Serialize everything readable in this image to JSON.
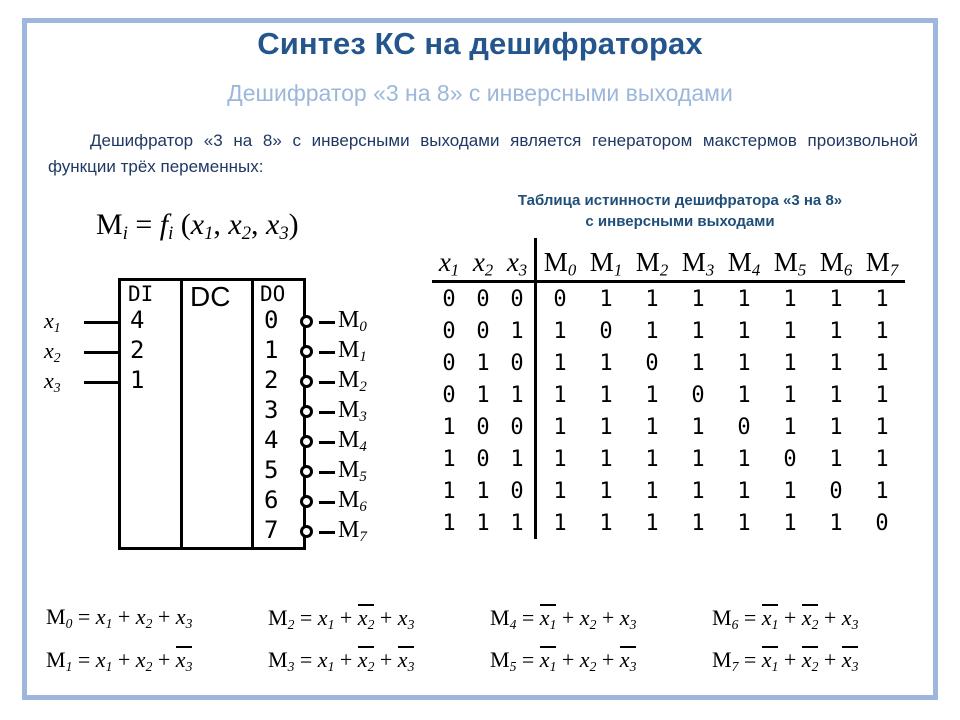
{
  "slide": {
    "title": "Синтез КС на дешифраторах",
    "subtitle": "Дешифратор «3 на 8» с инверсными выходами",
    "intro": "Дешифратор «3 на 8» с инверсными выходами является генератором макстермов произвольной функции трёх переменных:",
    "accent_color": "#24558C",
    "subtitle_color": "#9CB7DC",
    "frame_color": "#9DB6DC",
    "caption_color": "#1F4E79"
  },
  "main_formula": {
    "lhs": "M",
    "lhs_sub": "i",
    "eq": " = ",
    "fn": "f",
    "fn_sub": "i",
    "args": "(x1, x2, x3)",
    "plain": "M_i = f_i (x1, x2, x3)"
  },
  "decoder": {
    "title_di": "DI",
    "title_dc": "DC",
    "title_do": "DO",
    "inputs": [
      {
        "label": "x",
        "sub": "1",
        "weight": "4"
      },
      {
        "label": "x",
        "sub": "2",
        "weight": "2"
      },
      {
        "label": "x",
        "sub": "3",
        "weight": "1"
      }
    ],
    "outputs": [
      {
        "index": "0",
        "label": "M",
        "sub": "0"
      },
      {
        "index": "1",
        "label": "M",
        "sub": "1"
      },
      {
        "index": "2",
        "label": "M",
        "sub": "2"
      },
      {
        "index": "3",
        "label": "M",
        "sub": "3"
      },
      {
        "index": "4",
        "label": "M",
        "sub": "4"
      },
      {
        "index": "5",
        "label": "M",
        "sub": "5"
      },
      {
        "index": "6",
        "label": "M",
        "sub": "6"
      },
      {
        "index": "7",
        "label": "M",
        "sub": "7"
      }
    ]
  },
  "truth_table": {
    "caption_line1": "Таблица истинности дешифратора «3 на 8»",
    "caption_line2": "с инверсными выходами",
    "input_headers": [
      {
        "base": "x",
        "sub": "1"
      },
      {
        "base": "x",
        "sub": "2"
      },
      {
        "base": "x",
        "sub": "3"
      }
    ],
    "output_headers": [
      {
        "base": "M",
        "sub": "0"
      },
      {
        "base": "M",
        "sub": "1"
      },
      {
        "base": "M",
        "sub": "2"
      },
      {
        "base": "M",
        "sub": "3"
      },
      {
        "base": "M",
        "sub": "4"
      },
      {
        "base": "M",
        "sub": "5"
      },
      {
        "base": "M",
        "sub": "6"
      },
      {
        "base": "M",
        "sub": "7"
      }
    ],
    "rows": [
      {
        "inputs": [
          "0",
          "0",
          "0"
        ],
        "outputs": [
          "0",
          "1",
          "1",
          "1",
          "1",
          "1",
          "1",
          "1"
        ]
      },
      {
        "inputs": [
          "0",
          "0",
          "1"
        ],
        "outputs": [
          "1",
          "0",
          "1",
          "1",
          "1",
          "1",
          "1",
          "1"
        ]
      },
      {
        "inputs": [
          "0",
          "1",
          "0"
        ],
        "outputs": [
          "1",
          "1",
          "0",
          "1",
          "1",
          "1",
          "1",
          "1"
        ]
      },
      {
        "inputs": [
          "0",
          "1",
          "1"
        ],
        "outputs": [
          "1",
          "1",
          "1",
          "0",
          "1",
          "1",
          "1",
          "1"
        ]
      },
      {
        "inputs": [
          "1",
          "0",
          "0"
        ],
        "outputs": [
          "1",
          "1",
          "1",
          "1",
          "0",
          "1",
          "1",
          "1"
        ]
      },
      {
        "inputs": [
          "1",
          "0",
          "1"
        ],
        "outputs": [
          "1",
          "1",
          "1",
          "1",
          "1",
          "0",
          "1",
          "1"
        ]
      },
      {
        "inputs": [
          "1",
          "1",
          "0"
        ],
        "outputs": [
          "1",
          "1",
          "1",
          "1",
          "1",
          "1",
          "0",
          "1"
        ]
      },
      {
        "inputs": [
          "1",
          "1",
          "1"
        ],
        "outputs": [
          "1",
          "1",
          "1",
          "1",
          "1",
          "1",
          "1",
          "0"
        ]
      }
    ]
  },
  "maxterm_equations": [
    {
      "name": "M",
      "sub": "0",
      "terms": [
        {
          "base": "x",
          "sub": "1",
          "inv": false
        },
        {
          "base": "x",
          "sub": "2",
          "inv": false
        },
        {
          "base": "x",
          "sub": "3",
          "inv": false
        }
      ]
    },
    {
      "name": "M",
      "sub": "1",
      "terms": [
        {
          "base": "x",
          "sub": "1",
          "inv": false
        },
        {
          "base": "x",
          "sub": "2",
          "inv": false
        },
        {
          "base": "x",
          "sub": "3",
          "inv": true
        }
      ]
    },
    {
      "name": "M",
      "sub": "2",
      "terms": [
        {
          "base": "x",
          "sub": "1",
          "inv": false
        },
        {
          "base": "x",
          "sub": "2",
          "inv": true
        },
        {
          "base": "x",
          "sub": "3",
          "inv": false
        }
      ]
    },
    {
      "name": "M",
      "sub": "3",
      "terms": [
        {
          "base": "x",
          "sub": "1",
          "inv": false
        },
        {
          "base": "x",
          "sub": "2",
          "inv": true
        },
        {
          "base": "x",
          "sub": "3",
          "inv": true
        }
      ]
    },
    {
      "name": "M",
      "sub": "4",
      "terms": [
        {
          "base": "x",
          "sub": "1",
          "inv": true
        },
        {
          "base": "x",
          "sub": "2",
          "inv": false
        },
        {
          "base": "x",
          "sub": "3",
          "inv": false
        }
      ]
    },
    {
      "name": "M",
      "sub": "5",
      "terms": [
        {
          "base": "x",
          "sub": "1",
          "inv": true
        },
        {
          "base": "x",
          "sub": "2",
          "inv": false
        },
        {
          "base": "x",
          "sub": "3",
          "inv": true
        }
      ]
    },
    {
      "name": "M",
      "sub": "6",
      "terms": [
        {
          "base": "x",
          "sub": "1",
          "inv": true
        },
        {
          "base": "x",
          "sub": "2",
          "inv": true
        },
        {
          "base": "x",
          "sub": "3",
          "inv": false
        }
      ]
    },
    {
      "name": "M",
      "sub": "7",
      "terms": [
        {
          "base": "x",
          "sub": "1",
          "inv": true
        },
        {
          "base": "x",
          "sub": "2",
          "inv": true
        },
        {
          "base": "x",
          "sub": "3",
          "inv": true
        }
      ]
    }
  ],
  "symbols": {
    "plus": "+",
    "equals": "="
  }
}
